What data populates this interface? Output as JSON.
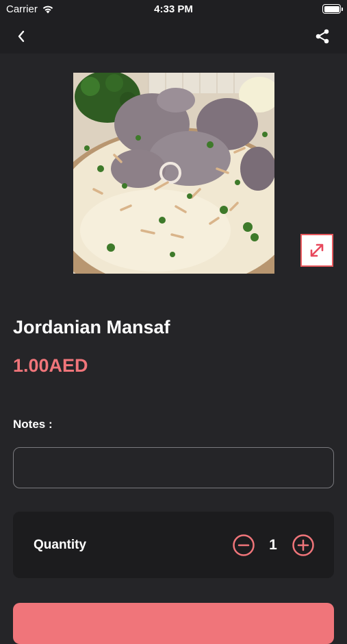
{
  "status_bar": {
    "carrier": "Carrier",
    "time": "4:33 PM"
  },
  "nav": {
    "back_icon": "chevron-left-icon",
    "share_icon": "share-icon"
  },
  "product": {
    "name": "Jordanian Mansaf",
    "price": "1.00AED"
  },
  "notes": {
    "label": "Notes :",
    "value": "",
    "placeholder": ""
  },
  "quantity": {
    "label": "Quantity",
    "value": "1"
  },
  "colors": {
    "background": "#252528",
    "bar": "#1f1f22",
    "accent": "#f0757a",
    "card": "#1c1c1e"
  }
}
